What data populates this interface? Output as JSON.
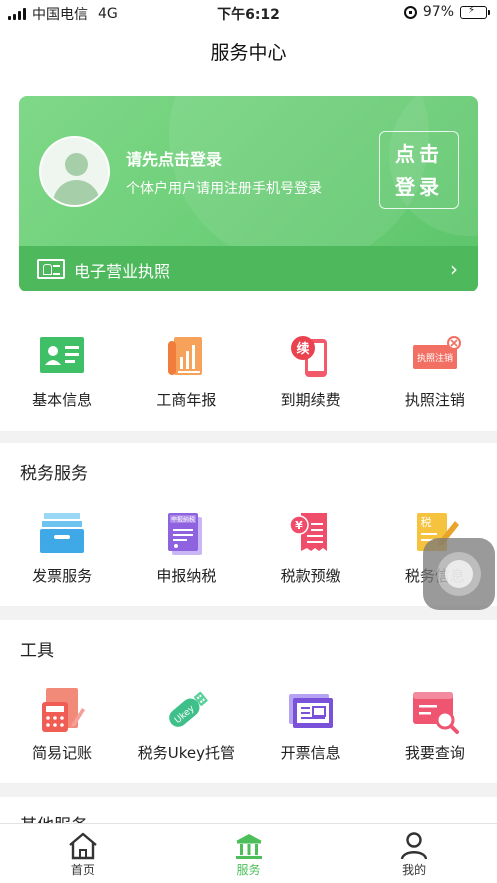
{
  "status_bar": {
    "carrier": "中国电信",
    "network": "4G",
    "time": "下午6:12",
    "battery_percent": "97%",
    "battery_level": 0.97
  },
  "nav": {
    "title": "服务中心"
  },
  "profile_card": {
    "login_title": "请先点击登录",
    "login_subtitle": "个体户用户请用注册手机号登录",
    "login_button_line1": "点击",
    "login_button_line2": "登录",
    "license_label": "电子营业执照",
    "accent_color": "#6fd07a"
  },
  "quick_actions": [
    {
      "label": "基本信息",
      "icon": "id-card-icon"
    },
    {
      "label": "工商年报",
      "icon": "annual-report-icon"
    },
    {
      "label": "到期续费",
      "icon": "renew-phone-icon"
    },
    {
      "label": "执照注销",
      "icon": "license-cancel-icon"
    }
  ],
  "tax_services": {
    "title": "税务服务",
    "items": [
      {
        "label": "发票服务",
        "icon": "invoice-box-icon"
      },
      {
        "label": "申报纳税",
        "icon": "tax-declaration-icon",
        "badge": "申报纳税"
      },
      {
        "label": "税款预缴",
        "icon": "tax-prepay-icon",
        "badge": "¥"
      },
      {
        "label": "税务信息",
        "icon": "tax-info-icon",
        "badge": "税"
      }
    ]
  },
  "tools": {
    "title": "工具",
    "items": [
      {
        "label": "简易记账",
        "icon": "bookkeeping-icon"
      },
      {
        "label": "税务Ukey托管",
        "icon": "ukey-icon",
        "badge": "Ukey"
      },
      {
        "label": "开票信息",
        "icon": "invoice-info-icon"
      },
      {
        "label": "我要查询",
        "icon": "query-icon"
      }
    ]
  },
  "other_services": {
    "title": "其他服务"
  },
  "license_cancel_badge": "执照注销",
  "renew_badge": "续",
  "tabbar": [
    {
      "label": "首页",
      "icon": "home-icon",
      "active": false
    },
    {
      "label": "服务",
      "icon": "bank-icon",
      "active": true
    },
    {
      "label": "我的",
      "icon": "user-icon",
      "active": false
    }
  ]
}
